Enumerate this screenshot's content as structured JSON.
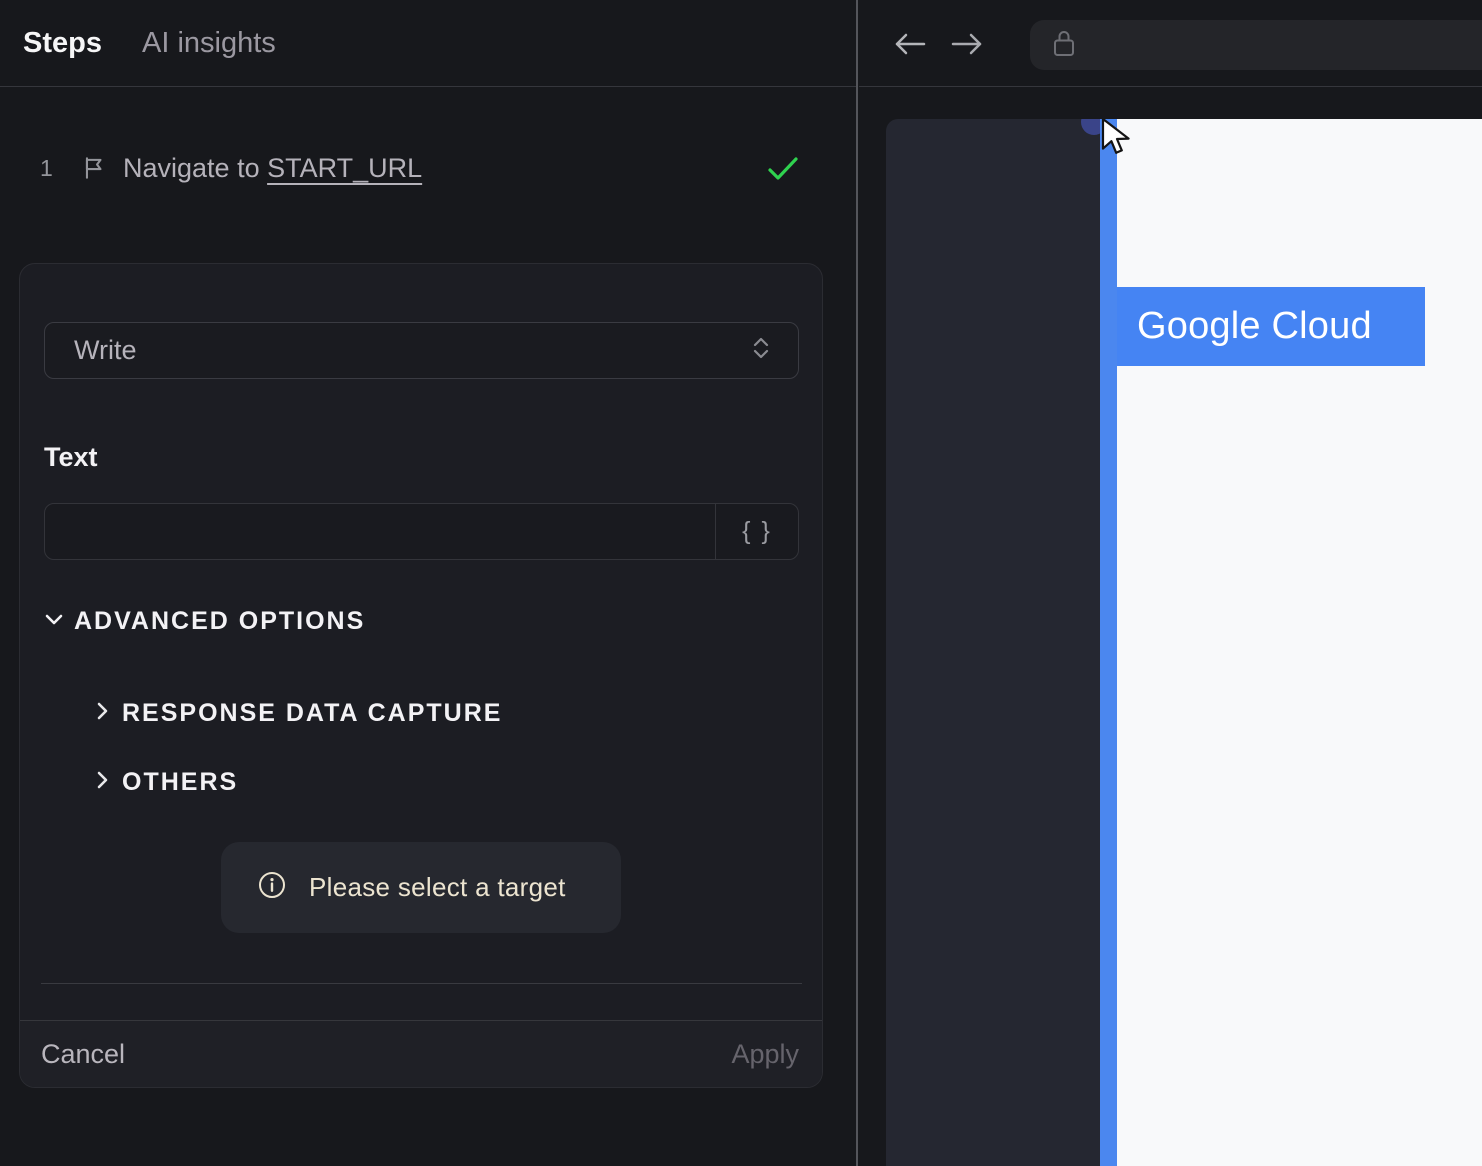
{
  "tabs": [
    {
      "label": "Steps",
      "active": true
    },
    {
      "label": "AI insights",
      "active": false
    }
  ],
  "step": {
    "number": "1",
    "title_prefix": "Navigate to ",
    "title_link": "START_URL",
    "status": "success"
  },
  "editor": {
    "action_select": {
      "value": "Write"
    },
    "text_section": {
      "label": "Text",
      "input_value": "",
      "variables_button": "{ }"
    },
    "advanced_options": {
      "label": "ADVANCED OPTIONS",
      "expanded": true,
      "sections": [
        {
          "label": "RESPONSE DATA CAPTURE",
          "expanded": false
        },
        {
          "label": "OTHERS",
          "expanded": false
        }
      ]
    },
    "notice": {
      "text": "Please select a target"
    },
    "footer": {
      "cancel": "Cancel",
      "apply": "Apply",
      "apply_enabled": false
    }
  },
  "browser": {
    "address_value": "",
    "page": {
      "highlight_label": "Google Cloud"
    }
  },
  "colors": {
    "accent_blue": "#4584f3",
    "highlight_bar_blue": "#4b87ef",
    "selection_dot_navy": "#3a4489",
    "success_green": "#2fd24f",
    "notice_cream": "#ece4d0",
    "page_bg": "#17181c",
    "card_bg": "#1c1d23",
    "dark_page_bg": "#252731",
    "white_page_bg": "#f8f9fa"
  }
}
